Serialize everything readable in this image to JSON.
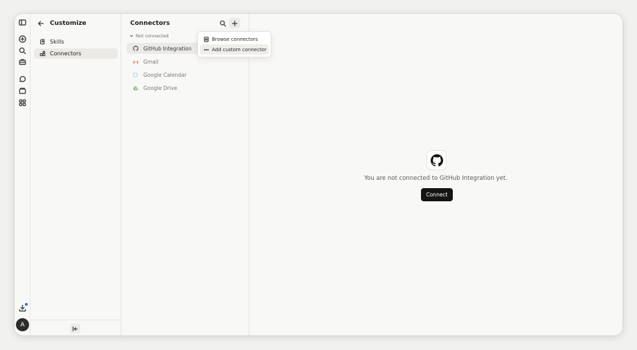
{
  "customize": {
    "title": "Customize",
    "nav": [
      {
        "label": "Skills",
        "icon": "scroll-icon"
      },
      {
        "label": "Connectors",
        "icon": "connectors-icon"
      }
    ]
  },
  "connectors": {
    "title": "Connectors",
    "section_label": "Not connected",
    "items": [
      {
        "label": "GitHub Integration",
        "icon": "github-icon"
      },
      {
        "label": "Gmail",
        "icon": "gmail-icon"
      },
      {
        "label": "Google Calendar",
        "icon": "calendar-icon"
      },
      {
        "label": "Google Drive",
        "icon": "drive-icon"
      }
    ]
  },
  "popover": {
    "items": [
      {
        "label": "Browse connectors",
        "icon": "grid-icon"
      },
      {
        "label": "Add custom connector",
        "icon": "dots-icon"
      }
    ]
  },
  "detail": {
    "message": "You are not connected to GitHub Integration yet.",
    "connect_label": "Connect"
  },
  "user": {
    "avatar_initial": "A"
  },
  "colors": {
    "accent_dot": "#2f6fe4",
    "primary_button": "#151514"
  }
}
